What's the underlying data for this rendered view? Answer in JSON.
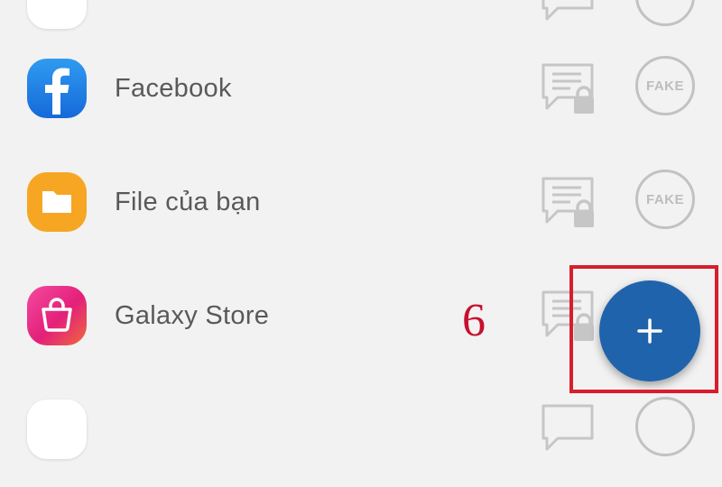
{
  "apps": [
    {
      "name": "",
      "icon": "blank-app-icon",
      "actions": [
        "lock-message-icon",
        "fake-icon"
      ]
    },
    {
      "name": "Facebook",
      "icon": "facebook-icon",
      "actions": [
        "lock-message-icon",
        "fake-icon"
      ]
    },
    {
      "name": "File của bạn",
      "icon": "folder-icon",
      "actions": [
        "lock-message-icon",
        "fake-icon"
      ]
    },
    {
      "name": "Galaxy Store",
      "icon": "shopping-bag-icon",
      "actions": [
        "lock-message-icon"
      ]
    },
    {
      "name": "",
      "icon": "blank-app-icon",
      "actions": [
        "lock-message-icon",
        "fake-icon"
      ]
    }
  ],
  "fake_label": "FAKE",
  "annotation": {
    "step_number": "6",
    "color": "#c8102e"
  },
  "fab": {
    "icon": "plus-icon",
    "color": "#1f63ac"
  },
  "colors": {
    "background": "#f2f2f2",
    "facebook": "#1877f2",
    "files": "#f6a623",
    "galaxy_store": "#e3207a",
    "highlight": "#d81e2c"
  }
}
